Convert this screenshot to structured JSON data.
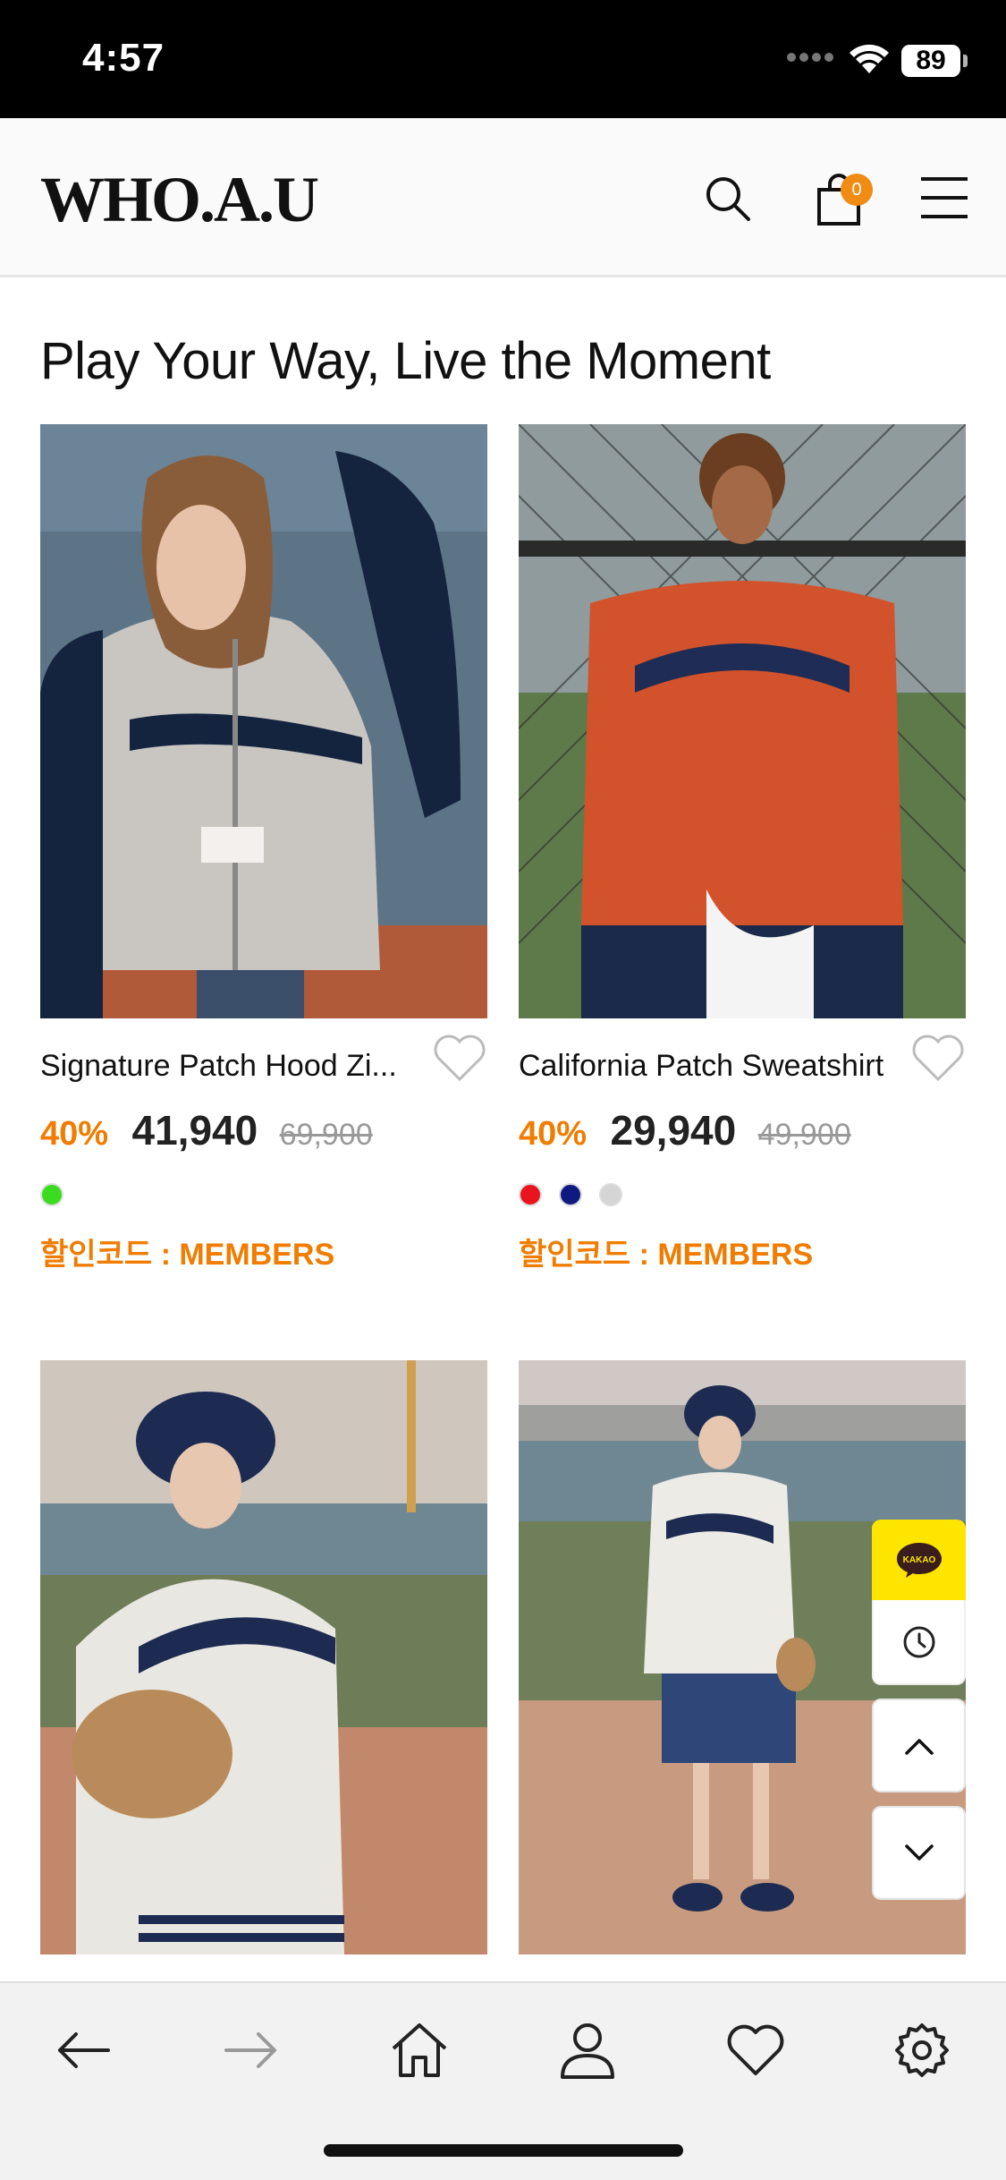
{
  "status": {
    "time": "4:57",
    "battery": "89"
  },
  "header": {
    "logo": "WHO.A.U",
    "cart_count": "0"
  },
  "section": {
    "title": "Play Your Way, Live the Moment"
  },
  "products": [
    {
      "name": "Signature Patch Hood Zi...",
      "discount": "40%",
      "price": "41,940",
      "original_price": "69,900",
      "colors": [
        "#3bdc1f"
      ],
      "coupon": "할인코드 : MEMBERS"
    },
    {
      "name": "California Patch Sweatshirt",
      "discount": "40%",
      "price": "29,940",
      "original_price": "49,900",
      "colors": [
        "#e8141e",
        "#0f1a80",
        "#d5d5d5"
      ],
      "coupon": "할인코드 : MEMBERS"
    },
    {
      "name": "",
      "image": "white varsity jacket with baseball glove"
    },
    {
      "name": "",
      "image": "white varsity jacket on baseball field"
    }
  ],
  "floating": {
    "kakao_label": "KAKAO"
  },
  "bottom_nav": [
    "back-icon",
    "forward-icon",
    "home-icon",
    "profile-icon",
    "heart-icon",
    "settings-icon"
  ],
  "colors": {
    "accent": "#f07c00",
    "cart_badge": "#f08b14",
    "kakao": "#fde500"
  }
}
